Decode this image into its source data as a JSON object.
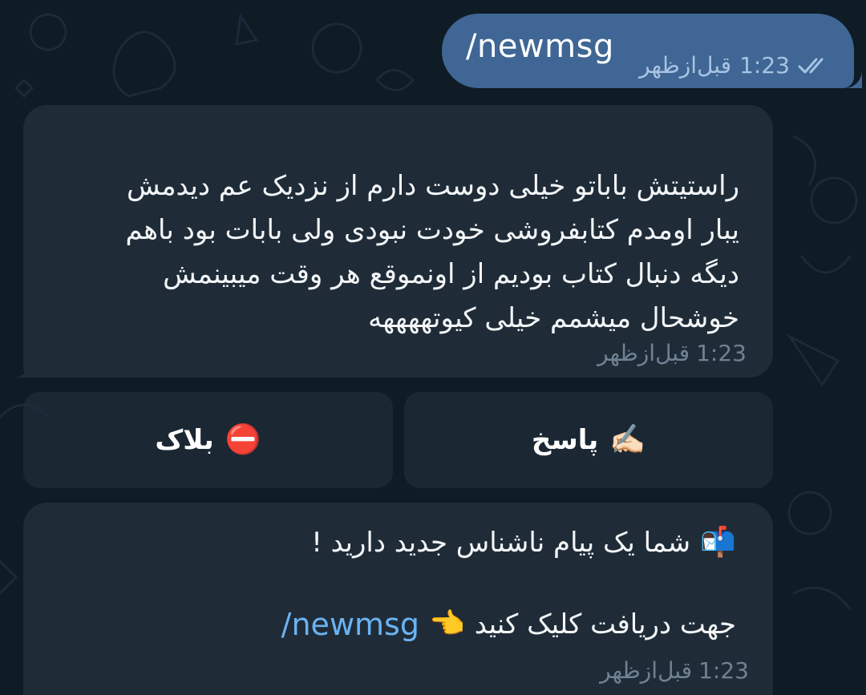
{
  "outgoing": {
    "text": "/newmsg",
    "time": "1:23",
    "period": "قبل‌ازظهر"
  },
  "incoming": {
    "lines": [
      "راستیتش باباتو خیلی دوست دارم از نزدیک عم دیدمش",
      "یبار اومدم کتابفروشی خودت نبودی ولی بابات بود باهم",
      "دیگه دنبال کتاب بودیم از اونموقع هر وقت میبینمش",
      "خوشحال میشمم خیلی کیوتههههه"
    ],
    "time": "1:23",
    "period": "قبل‌ازظهر"
  },
  "keyboard": {
    "reply_label": "پاسخ",
    "reply_emoji": "✍🏻",
    "block_label": "بلاک",
    "block_emoji": "⛔"
  },
  "notice": {
    "emoji_mailbox": "📬",
    "line1": "شما یک پیام ناشناس جدید دارید !",
    "line2": "جهت دریافت کلیک کنید",
    "pointer_emoji": "👈",
    "link": "/newmsg",
    "time": "1:23",
    "period": "قبل‌ازظهر"
  },
  "colors": {
    "background": "#0f1b25",
    "outgoing_bubble": "#3f6694",
    "incoming_bubble": "#1f2c38",
    "link": "#6ab3f3"
  }
}
